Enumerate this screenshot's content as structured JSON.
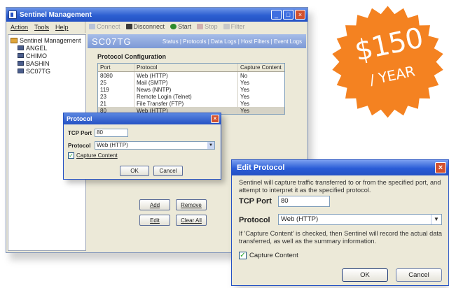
{
  "main_window": {
    "title": "Sentinel Management",
    "controls": {
      "minimize": "_",
      "maximize": "□",
      "close": "×"
    },
    "menu": [
      "Action",
      "Tools",
      "Help"
    ],
    "toolbar": [
      {
        "label": "Connect",
        "enabled": false
      },
      {
        "label": "Disconnect",
        "enabled": true
      },
      {
        "label": "Start",
        "enabled": true
      },
      {
        "label": "Stop",
        "enabled": false
      },
      {
        "label": "Filter",
        "enabled": false
      }
    ]
  },
  "tree": {
    "root": "Sentinel Management",
    "hosts": [
      "ANGEL",
      "CHIMO",
      "BASHIN",
      "SC07TG"
    ]
  },
  "right_pane": {
    "host": "SC07TG",
    "links": "Status | Protocols | Data Logs | Host Filters | Event Logs",
    "section_title": "Protocol Configuration",
    "columns": [
      "Port",
      "Protocol",
      "Capture Content"
    ],
    "rows": [
      {
        "port": "8080",
        "protocol": "Web (HTTP)",
        "capture": "No"
      },
      {
        "port": "25",
        "protocol": "Mail (SMTP)",
        "capture": "Yes"
      },
      {
        "port": "119",
        "protocol": "News (NNTP)",
        "capture": "Yes"
      },
      {
        "port": "23",
        "protocol": "Remote Login (Telnet)",
        "capture": "Yes"
      },
      {
        "port": "21",
        "protocol": "File Transfer (FTP)",
        "capture": "Yes"
      },
      {
        "port": "80",
        "protocol": "Web (HTTP)",
        "capture": "Yes"
      }
    ],
    "buttons": {
      "add": "Add",
      "remove": "Remove",
      "edit": "Edit",
      "clear_all": "Clear All"
    }
  },
  "small_dialog": {
    "title": "Protocol",
    "tcp_port_label": "TCP Port",
    "tcp_port_value": "80",
    "protocol_label": "Protocol",
    "protocol_value": "Web (HTTP)",
    "capture_label": "Capture Content",
    "capture_checked": true,
    "ok": "OK",
    "cancel": "Cancel"
  },
  "badge": {
    "price": "$150",
    "period": "/ YEAR",
    "color": "#f48221"
  },
  "edit_dialog": {
    "title": "Edit Protocol",
    "intro": "Sentinel will capture traffic transferred to or from the specified port, and attempt to interpret it as the specified protocol.",
    "tcp_port_label": "TCP Port",
    "tcp_port_value": "80",
    "protocol_label": "Protocol",
    "protocol_value": "Web (HTTP)",
    "note": "If 'Capture Content' is checked, then Sentinel will record the actual data transferred, as well as the summary information.",
    "capture_label": "Capture Content",
    "capture_checked": true,
    "ok": "OK",
    "cancel": "Cancel"
  }
}
